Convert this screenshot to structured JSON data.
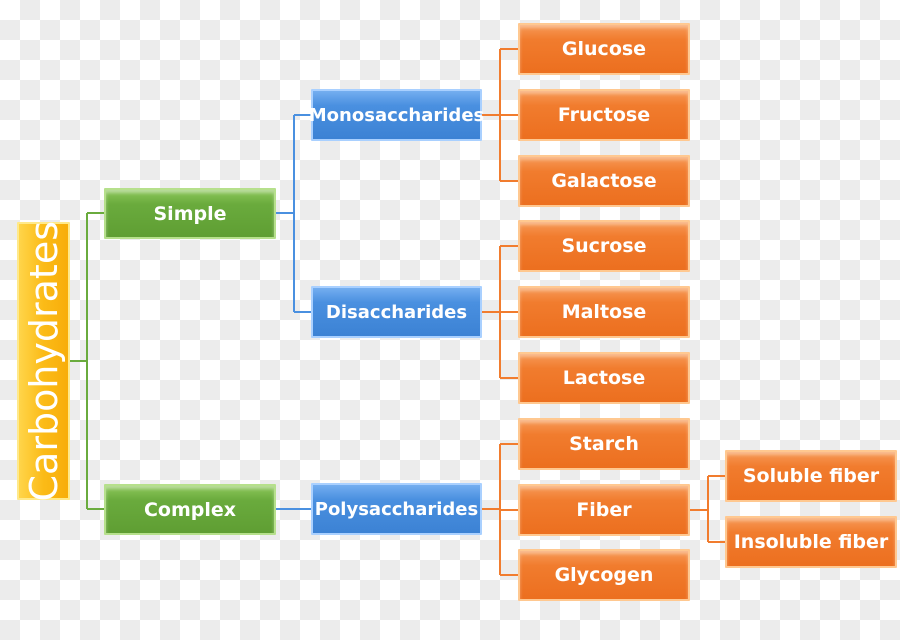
{
  "root": "Carbohydrates",
  "level1": [
    "Simple",
    "Complex"
  ],
  "level2": [
    "Monosaccharides",
    "Disaccharides",
    "Polysaccharides"
  ],
  "level3": [
    "Glucose",
    "Fructose",
    "Galactose",
    "Sucrose",
    "Maltose",
    "Lactose",
    "Starch",
    "Fiber",
    "Glycogen"
  ],
  "level4": [
    "Soluble fiber",
    "Insoluble fiber"
  ],
  "colors": {
    "root": "#fbbb17",
    "level1": "#6aab3d",
    "level2": "#4a90e0",
    "level3": "#f17c2e",
    "level4": "#f17c2e"
  }
}
